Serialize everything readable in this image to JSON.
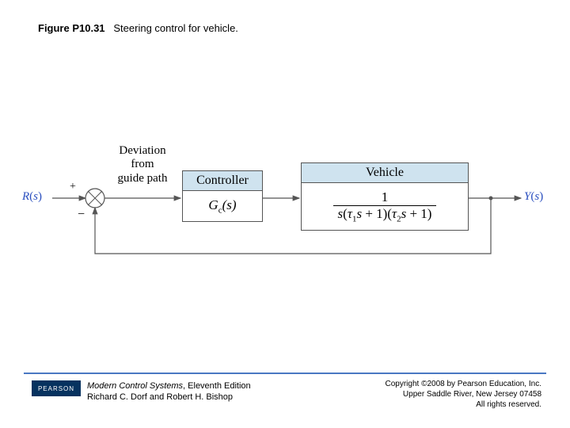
{
  "figure": {
    "id": "Figure P10.31",
    "caption": "Steering control for vehicle."
  },
  "diagram": {
    "input": "R(s)",
    "output": "Y(s)",
    "summing": {
      "plus": "+",
      "minus": "−"
    },
    "deviation_label": "Deviation\nfrom\nguide path",
    "controller": {
      "title": "Controller",
      "body": "G_c(s)"
    },
    "vehicle": {
      "title": "Vehicle",
      "tf_num": "1",
      "tf_den": "s(τ₁s + 1)(τ₂s + 1)"
    }
  },
  "footer": {
    "publisher_logo": "PEARSON",
    "book_title": "Modern Control Systems",
    "edition": ", Eleventh Edition",
    "authors": "Richard C. Dorf and Robert H. Bishop",
    "copyright1": "Copyright ©2008 by Pearson Education, Inc.",
    "copyright2": "Upper Saddle River, New Jersey 07458",
    "copyright3": "All rights reserved."
  }
}
